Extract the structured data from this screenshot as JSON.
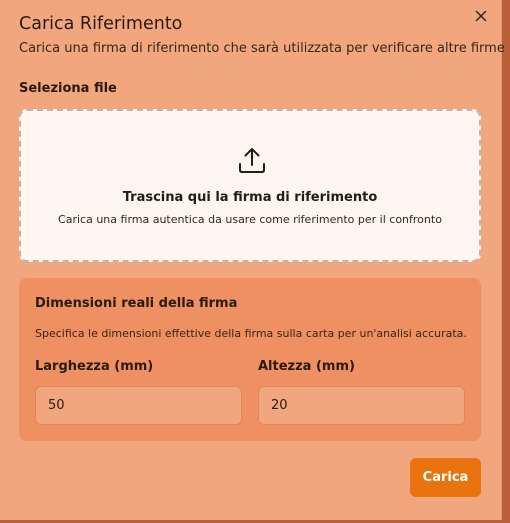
{
  "dialog": {
    "title": "Carica Riferimento",
    "subtitle": "Carica una firma di riferimento che sarà utilizzata per verificare altre firme",
    "close_icon": "close-icon"
  },
  "file": {
    "label": "Seleziona file",
    "dropzone_title": "Trascina qui la firma di riferimento",
    "dropzone_subtitle": "Carica una firma autentica da usare come riferimento per il confronto",
    "icon": "upload-icon"
  },
  "dimensions": {
    "title": "Dimensioni reali della firma",
    "description": "Specifica le dimensioni effettive della firma sulla carta per un'analisi accurata.",
    "width_label": "Larghezza (mm)",
    "width_value": "50",
    "height_label": "Altezza (mm)",
    "height_value": "20"
  },
  "actions": {
    "submit_label": "Carica"
  },
  "colors": {
    "dialog_bg": "#f2a67e",
    "dropzone_bg": "#fff6f2",
    "panel_bg": "#ee9061",
    "accent": "#e8730f"
  }
}
